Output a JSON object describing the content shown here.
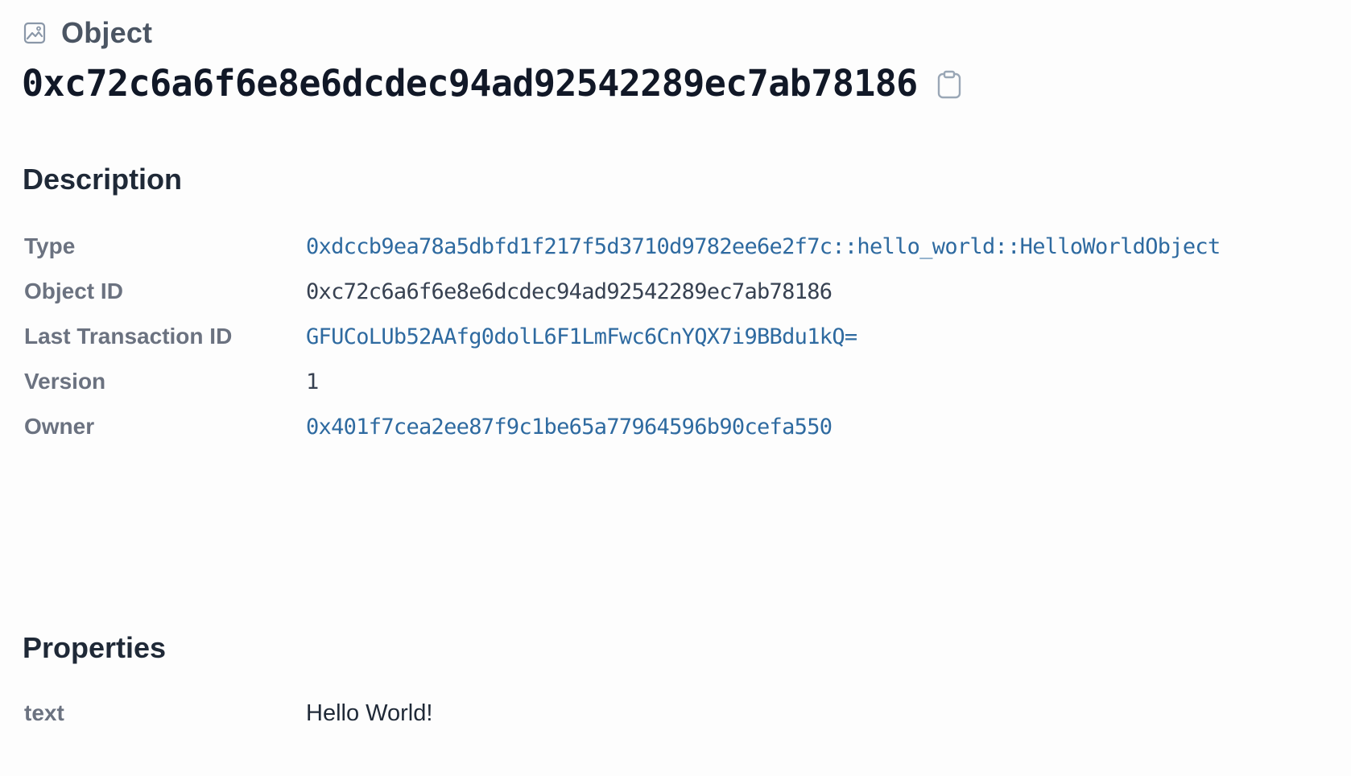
{
  "header": {
    "kind_icon": "image-icon",
    "kind_label": "Object",
    "object_id_title": "0xc72c6a6f6e8e6dcdec94ad92542289ec7ab78186",
    "copy_icon": "clipboard-icon"
  },
  "description": {
    "title": "Description",
    "rows": [
      {
        "label": "Type",
        "value": "0xdccb9ea78a5dbfd1f217f5d3710d9782ee6e2f7c::hello_world::HelloWorldObject"
      },
      {
        "label": "Object ID",
        "value": "0xc72c6a6f6e8e6dcdec94ad92542289ec7ab78186"
      },
      {
        "label": "Last Transaction ID",
        "value": "GFUCoLUb52AAfg0dolL6F1LmFwc6CnYQX7i9BBdu1kQ="
      },
      {
        "label": "Version",
        "value": "1"
      },
      {
        "label": "Owner",
        "value": "0x401f7cea2ee87f9c1be65a77964596b90cefa550"
      }
    ]
  },
  "properties": {
    "title": "Properties",
    "rows": [
      {
        "label": "text",
        "value": "Hello World!"
      }
    ]
  },
  "colors": {
    "link": "#2e6aa0",
    "label": "#6b7280",
    "heading": "#1f2937",
    "icon": "#8a97a8"
  }
}
